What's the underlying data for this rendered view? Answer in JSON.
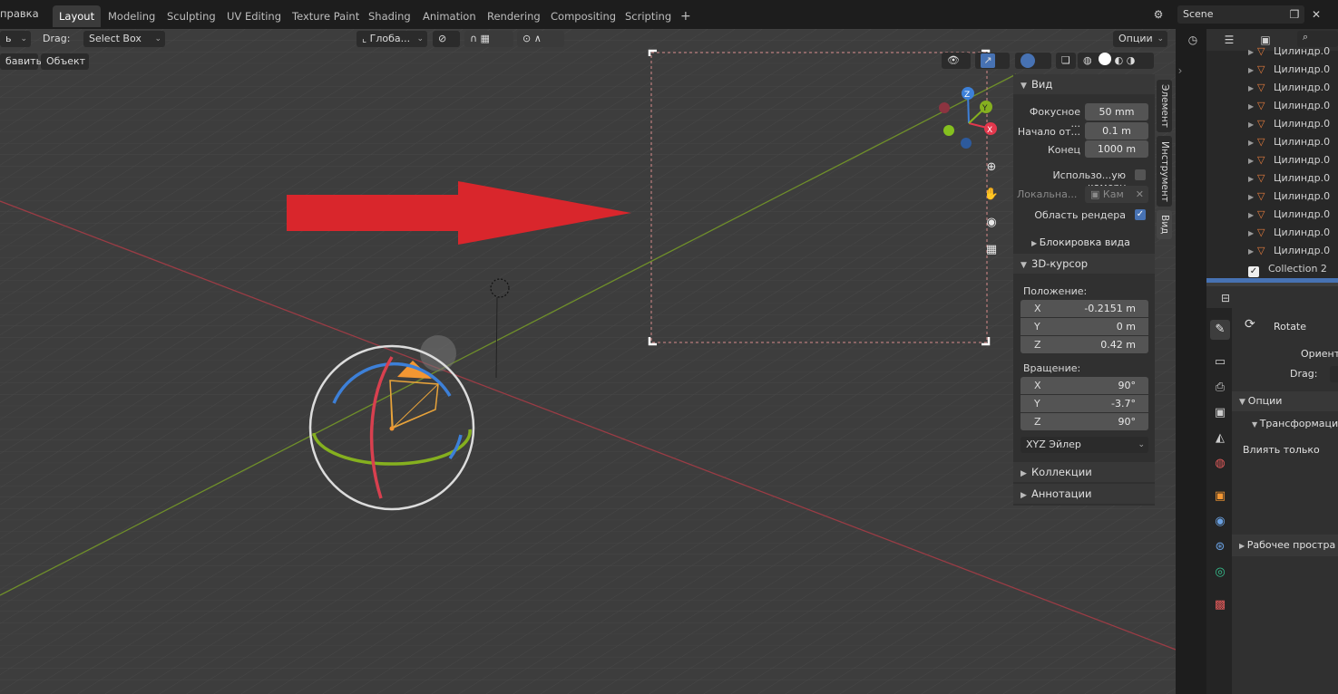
{
  "topbar": {
    "help_menu": "правка",
    "tabs": [
      "Layout",
      "Modeling",
      "Sculpting",
      "UV Editing",
      "Texture Paint",
      "Shading",
      "Animation",
      "Rendering",
      "Compositing",
      "Scripting"
    ],
    "active_tab": "Layout",
    "add_tab": "+",
    "scene_name": "Scene"
  },
  "viewport_header": {
    "mode_fragment": "ь",
    "drag_label": "Drag:",
    "drag_value": "Select Box",
    "menu_add": "бавить",
    "menu_object": "Объект",
    "orientation": "Глоба...",
    "options": "Опции"
  },
  "npanel": {
    "view_section": "Вид",
    "focal_label": "Фокусное ...",
    "focal_value": "50 mm",
    "clip_start_label": "Начало от...",
    "clip_start_value": "0.1 m",
    "clip_end_label": "Конец",
    "clip_end_value": "1000 m",
    "use_camera_label": "Использо...ую камеру",
    "local_camera_label": "Локальна...",
    "local_camera_value": "Кам",
    "render_region_label": "Область рендера",
    "view_lock": "Блокировка вида",
    "cursor_section": "3D-курсор",
    "position_label": "Положение:",
    "position": [
      {
        "axis": "X",
        "value": "-0.2151 m"
      },
      {
        "axis": "Y",
        "value": "0 m"
      },
      {
        "axis": "Z",
        "value": "0.42 m"
      }
    ],
    "rotation_label": "Вращение:",
    "rotation": [
      {
        "axis": "X",
        "value": "90°"
      },
      {
        "axis": "Y",
        "value": "-3.7°"
      },
      {
        "axis": "Z",
        "value": "90°"
      }
    ],
    "rotation_mode": "XYZ Эйлер",
    "collections": "Коллекции",
    "annotations": "Аннотации"
  },
  "side_tabs": {
    "element": "Элемент",
    "tool": "Инструмент",
    "view": "Вид"
  },
  "gizmo": {
    "x": "X",
    "y": "Y",
    "z": "Z"
  },
  "outliner": {
    "items": [
      "Цилиндр.0",
      "Цилиндр.0",
      "Цилиндр.0",
      "Цилиндр.0",
      "Цилиндр.0",
      "Цилиндр.0",
      "Цилиндр.0",
      "Цилиндр.0",
      "Цилиндр.0",
      "Цилиндр.0",
      "Цилиндр.0",
      "Цилиндр.0"
    ],
    "collection": "Collection 2"
  },
  "properties": {
    "tool_name": "Rotate",
    "orient_label": "Ориент",
    "drag_label": "Drag:",
    "options": "Опции",
    "transform": "Трансформаци",
    "affect_only": "Влиять только",
    "workspace": "Рабочее простра"
  },
  "colors": {
    "accent": "#4772b3",
    "x_axis": "#e3384d",
    "y_axis": "#85b01f",
    "z_axis": "#3d80d8",
    "arrow": "#d9262c"
  }
}
